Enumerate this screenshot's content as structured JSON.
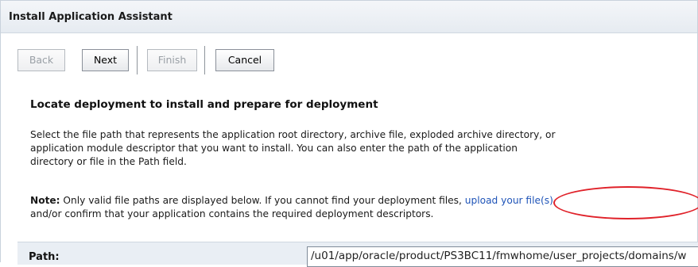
{
  "header": {
    "title": "Install Application Assistant"
  },
  "toolbar": {
    "back_label": "Back",
    "next_label": "Next",
    "finish_label": "Finish",
    "cancel_label": "Cancel"
  },
  "main": {
    "section_title": "Locate deployment to install and prepare for deployment",
    "description_lines": [
      "Select the file path that represents the application root directory, archive file, exploded archive directory, or",
      "application module descriptor that you want to install. You can also enter the path of the application",
      "directory or file in the Path field."
    ],
    "note": {
      "label": "Note:",
      "text_before_link": " Only valid file paths are displayed below. If you cannot find your deployment files,",
      "link_text": "upload your file(s)",
      "line2": "and/or confirm that your application contains the required deployment descriptors."
    },
    "path": {
      "label": "Path:",
      "value": "/u01/app/oracle/product/PS3BC11/fmwhome/user_projects/domains/w"
    }
  },
  "colors": {
    "link": "#1f54b8",
    "highlight": "#e0222a",
    "header_bg": "#eef1f5"
  }
}
